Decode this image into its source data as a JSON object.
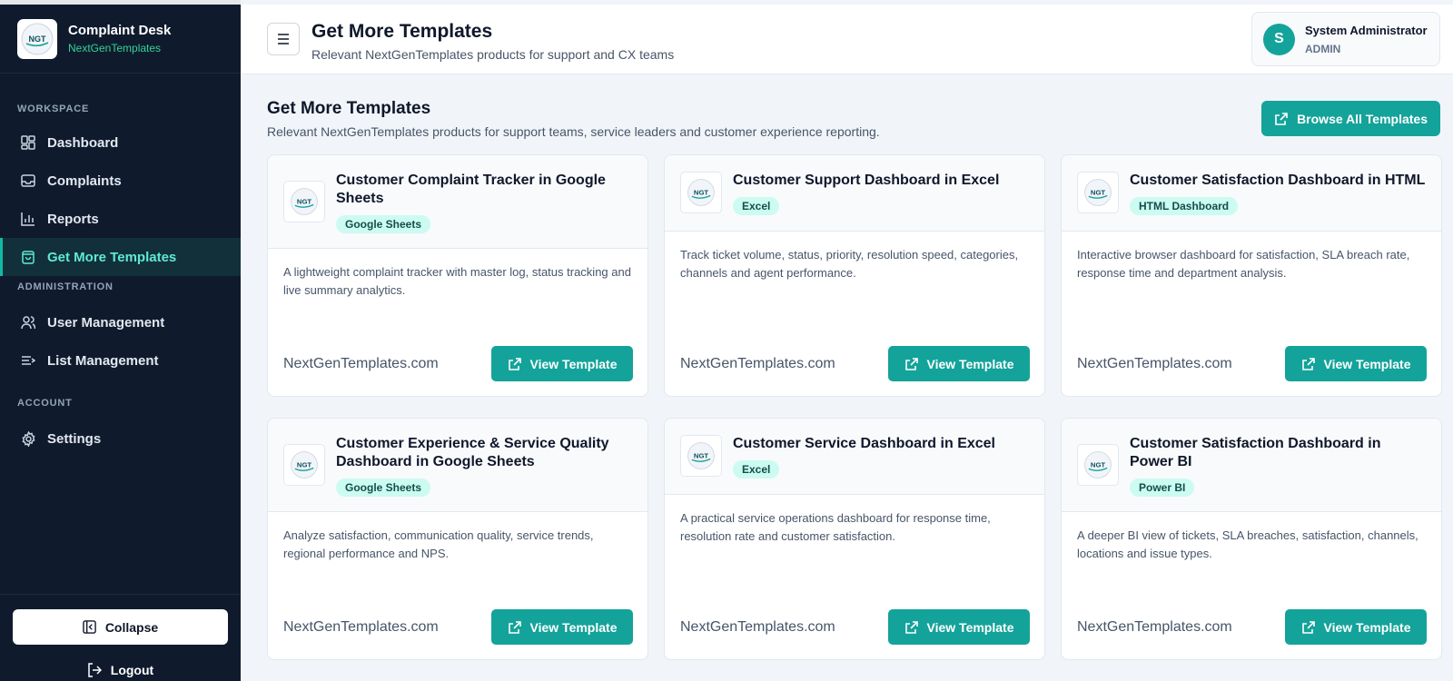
{
  "brand": {
    "title": "Complaint Desk",
    "subtitle": "NextGenTemplates",
    "logo_text": "NGT"
  },
  "nav": {
    "workspace_label": "WORKSPACE",
    "administration_label": "ADMINISTRATION",
    "account_label": "ACCOUNT",
    "items": [
      {
        "label": "Dashboard",
        "icon": "dashboard-icon"
      },
      {
        "label": "Complaints",
        "icon": "inbox-icon"
      },
      {
        "label": "Reports",
        "icon": "bar-chart-icon"
      },
      {
        "label": "Get More Templates",
        "icon": "shopping-bag-icon",
        "active": true
      },
      {
        "label": "User Management",
        "icon": "users-icon"
      },
      {
        "label": "List Management",
        "icon": "list-icon"
      },
      {
        "label": "Settings",
        "icon": "gear-icon"
      }
    ],
    "collapse_label": "Collapse",
    "logout_label": "Logout"
  },
  "header": {
    "title": "Get More Templates",
    "subtitle": "Relevant NextGenTemplates products for support and CX teams"
  },
  "user": {
    "initial": "S",
    "name": "System Administrator",
    "role": "ADMIN"
  },
  "main": {
    "title": "Get More Templates",
    "subtitle": "Relevant NextGenTemplates products for support teams, service leaders and customer experience reporting.",
    "browse_label": "Browse All Templates"
  },
  "cards": [
    {
      "title": "Customer Complaint Tracker in Google Sheets",
      "badge": "Google Sheets",
      "description": "A lightweight complaint tracker with master log, status tracking and live summary analytics.",
      "site": "NextGenTemplates.com",
      "button": "View Template"
    },
    {
      "title": "Customer Support Dashboard in Excel",
      "badge": "Excel",
      "description": "Track ticket volume, status, priority, resolution speed, categories, channels and agent performance.",
      "site": "NextGenTemplates.com",
      "button": "View Template"
    },
    {
      "title": "Customer Satisfaction Dashboard in HTML",
      "badge": "HTML Dashboard",
      "description": "Interactive browser dashboard for satisfaction, SLA breach rate, response time and department analysis.",
      "site": "NextGenTemplates.com",
      "button": "View Template"
    },
    {
      "title": "Customer Experience & Service Quality Dashboard in Google Sheets",
      "badge": "Google Sheets",
      "description": "Analyze satisfaction, communication quality, service trends, regional performance and NPS.",
      "site": "NextGenTemplates.com",
      "button": "View Template"
    },
    {
      "title": "Customer Service Dashboard in Excel",
      "badge": "Excel",
      "description": "A practical service operations dashboard for response time, resolution rate and customer satisfaction.",
      "site": "NextGenTemplates.com",
      "button": "View Template"
    },
    {
      "title": "Customer Satisfaction Dashboard in Power BI",
      "badge": "Power BI",
      "description": "A deeper BI view of tickets, SLA breaches, satisfaction, channels, locations and issue types.",
      "site": "NextGenTemplates.com",
      "button": "View Template"
    }
  ],
  "colors": {
    "sidebar": "#0f1b2d",
    "accent": "#14a39a",
    "active_text": "#5eead4",
    "badge_bg": "#ccfbf1"
  }
}
